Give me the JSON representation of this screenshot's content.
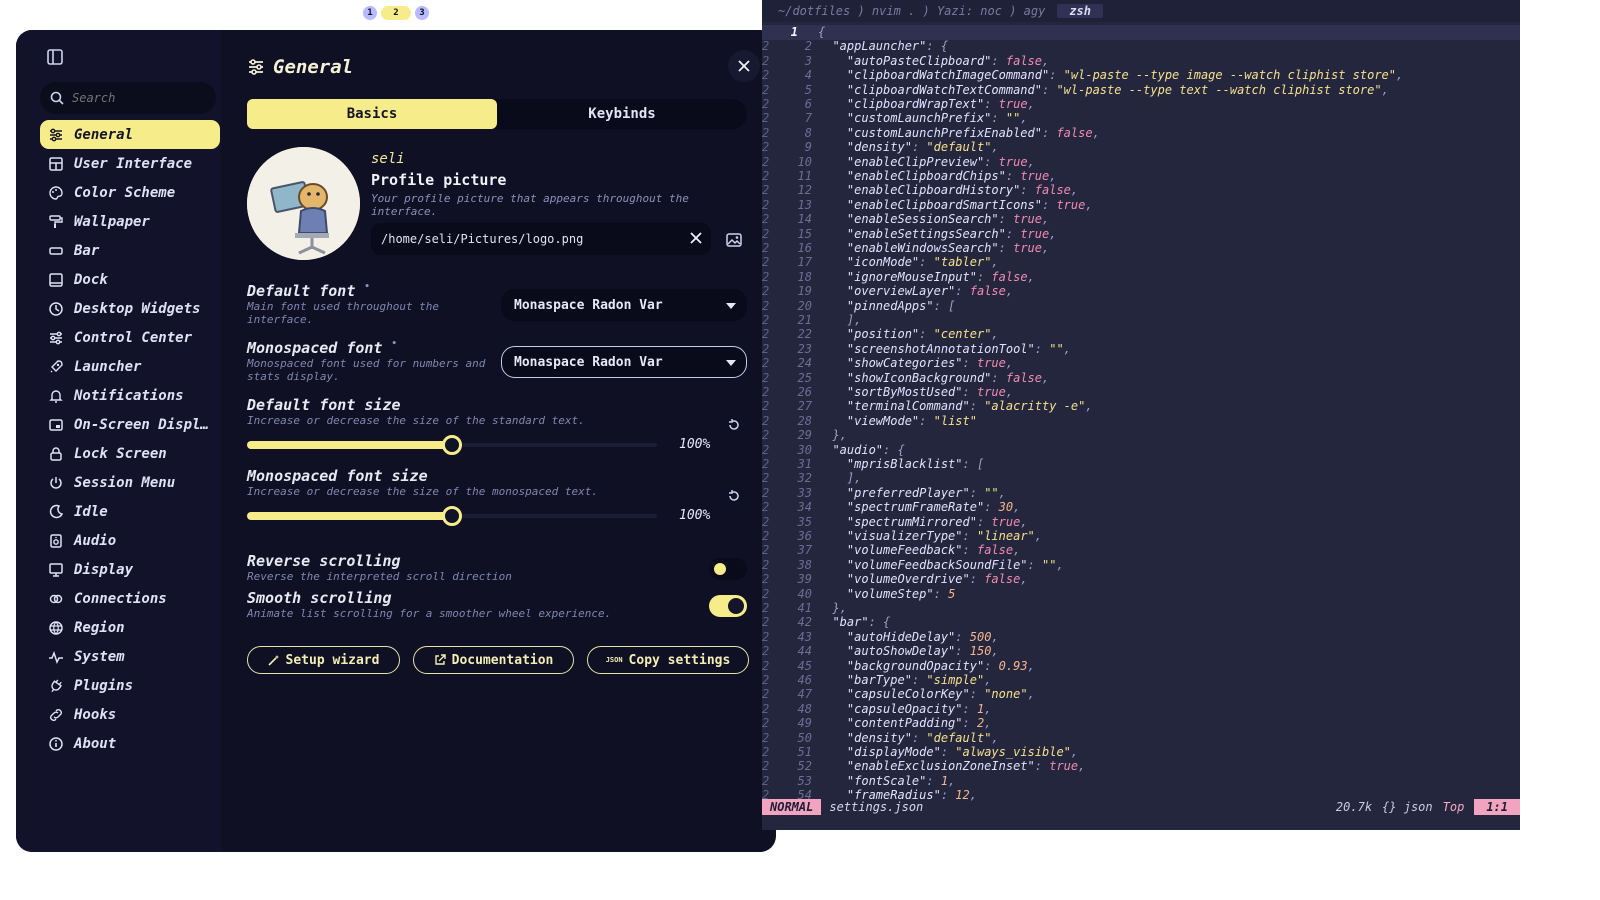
{
  "workspaces": [
    "1",
    "2",
    "3"
  ],
  "settings": {
    "title": "General",
    "search_placeholder": "Search",
    "nav": [
      {
        "label": "General",
        "icon": "sliders-icon",
        "active": true
      },
      {
        "label": "User Interface",
        "icon": "layout-icon"
      },
      {
        "label": "Color Scheme",
        "icon": "palette-icon"
      },
      {
        "label": "Wallpaper",
        "icon": "paint-roller-icon"
      },
      {
        "label": "Bar",
        "icon": "bar-icon"
      },
      {
        "label": "Dock",
        "icon": "dock-icon"
      },
      {
        "label": "Desktop Widgets",
        "icon": "clock-icon"
      },
      {
        "label": "Control Center",
        "icon": "toggles-icon"
      },
      {
        "label": "Launcher",
        "icon": "rocket-icon"
      },
      {
        "label": "Notifications",
        "icon": "bell-icon"
      },
      {
        "label": "On-Screen Displ…",
        "icon": "osd-icon"
      },
      {
        "label": "Lock Screen",
        "icon": "lock-icon"
      },
      {
        "label": "Session Menu",
        "icon": "power-icon"
      },
      {
        "label": "Idle",
        "icon": "moon-icon"
      },
      {
        "label": "Audio",
        "icon": "speaker-icon"
      },
      {
        "label": "Display",
        "icon": "monitor-icon"
      },
      {
        "label": "Connections",
        "icon": "link-icon"
      },
      {
        "label": "Region",
        "icon": "globe-icon"
      },
      {
        "label": "System",
        "icon": "pulse-icon"
      },
      {
        "label": "Plugins",
        "icon": "plug-icon"
      },
      {
        "label": "Hooks",
        "icon": "hook-icon"
      },
      {
        "label": "About",
        "icon": "info-icon"
      }
    ],
    "tabs": [
      "Basics",
      "Keybinds"
    ],
    "profile": {
      "username": "seli",
      "title": "Profile picture",
      "description": "Your profile picture that appears throughout the interface.",
      "path": "/home/seli/Pictures/logo.png"
    },
    "default_font": {
      "label": "Default font",
      "marker": "•",
      "description": "Main font used throughout the interface.",
      "value": "Monaspace Radon Var"
    },
    "mono_font": {
      "label": "Monospaced font",
      "marker": "•",
      "description": "Monospaced font used for numbers and stats display.",
      "value": "Monaspace Radon Var"
    },
    "default_size": {
      "label": "Default font size",
      "description": "Increase or decrease the size of the standard text.",
      "value": "100%",
      "fraction": 0.5
    },
    "mono_size": {
      "label": "Monospaced font size",
      "description": "Increase or decrease the size of the monospaced text.",
      "value": "100%",
      "fraction": 0.5
    },
    "reverse_scroll": {
      "label": "Reverse scrolling",
      "description": "Reverse the interpreted scroll direction",
      "on": false
    },
    "smooth_scroll": {
      "label": "Smooth scrolling",
      "description": "Animate list scrolling for a smoother wheel experience.",
      "on": true
    },
    "buttons": {
      "setup": "Setup wizard",
      "docs": "Documentation",
      "copy": "Copy settings",
      "copy_icon_text": "JSON"
    }
  },
  "terminal": {
    "title_path": "~/dotfiles ) nvim . ) Yazi: noc ) agy",
    "active_tab": "zsh",
    "status": {
      "mode": "NORMAL",
      "file": "settings.json",
      "size": "20.7k",
      "filetype": "{} json",
      "scroll": "Top",
      "position": "1:1"
    },
    "first_line_number": "1",
    "gutter": "2",
    "lines": [
      "{",
      "  \"appLauncher\": {",
      "    \"autoPasteClipboard\": false,",
      "    \"clipboardWatchImageCommand\": \"wl-paste --type image --watch cliphist store\",",
      "    \"clipboardWatchTextCommand\": \"wl-paste --type text --watch cliphist store\",",
      "    \"clipboardWrapText\": true,",
      "    \"customLaunchPrefix\": \"\",",
      "    \"customLaunchPrefixEnabled\": false,",
      "    \"density\": \"default\",",
      "    \"enableClipPreview\": true,",
      "    \"enableClipboardChips\": true,",
      "    \"enableClipboardHistory\": false,",
      "    \"enableClipboardSmartIcons\": true,",
      "    \"enableSessionSearch\": true,",
      "    \"enableSettingsSearch\": true,",
      "    \"enableWindowsSearch\": true,",
      "    \"iconMode\": \"tabler\",",
      "    \"ignoreMouseInput\": false,",
      "    \"overviewLayer\": false,",
      "    \"pinnedApps\": [",
      "    ],",
      "    \"position\": \"center\",",
      "    \"screenshotAnnotationTool\": \"\",",
      "    \"showCategories\": true,",
      "    \"showIconBackground\": false,",
      "    \"sortByMostUsed\": true,",
      "    \"terminalCommand\": \"alacritty -e\",",
      "    \"viewMode\": \"list\"",
      "  },",
      "  \"audio\": {",
      "    \"mprisBlacklist\": [",
      "    ],",
      "    \"preferredPlayer\": \"\",",
      "    \"spectrumFrameRate\": 30,",
      "    \"spectrumMirrored\": true,",
      "    \"visualizerType\": \"linear\",",
      "    \"volumeFeedback\": false,",
      "    \"volumeFeedbackSoundFile\": \"\",",
      "    \"volumeOverdrive\": false,",
      "    \"volumeStep\": 5",
      "  },",
      "  \"bar\": {",
      "    \"autoHideDelay\": 500,",
      "    \"autoShowDelay\": 150,",
      "    \"backgroundOpacity\": 0.93,",
      "    \"barType\": \"simple\",",
      "    \"capsuleColorKey\": \"none\",",
      "    \"capsuleOpacity\": 1,",
      "    \"contentPadding\": 2,",
      "    \"density\": \"default\",",
      "    \"displayMode\": \"always_visible\",",
      "    \"enableExclusionZoneInset\": true,",
      "    \"fontScale\": 1,",
      "    \"frameRadius\": 12,"
    ]
  },
  "colors": {
    "accent": "#f7ec8a",
    "bg": "#0f1024",
    "terminal_bg": "#24263e",
    "mode": "#f2a3c0"
  }
}
